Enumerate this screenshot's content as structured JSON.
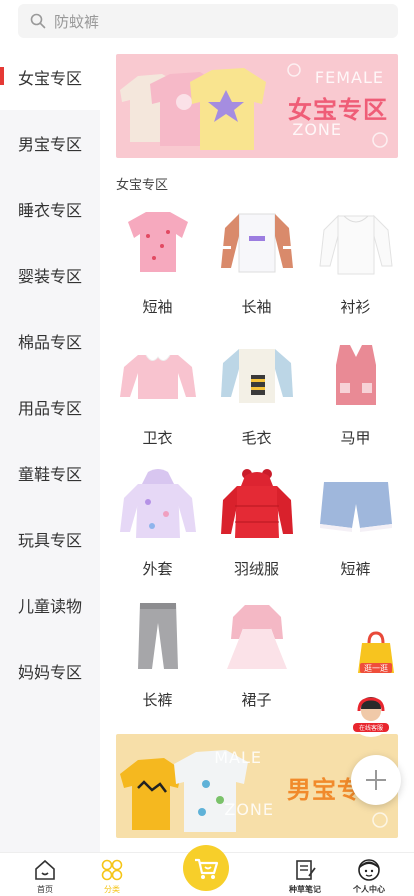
{
  "search": {
    "placeholder": "防蚊裤"
  },
  "sidebar": {
    "items": [
      {
        "label": "女宝专区"
      },
      {
        "label": "男宝专区"
      },
      {
        "label": "睡衣专区"
      },
      {
        "label": "婴装专区"
      },
      {
        "label": "棉品专区"
      },
      {
        "label": "用品专区"
      },
      {
        "label": "童鞋专区"
      },
      {
        "label": "玩具专区"
      },
      {
        "label": "儿童读物"
      },
      {
        "label": "妈妈专区"
      }
    ]
  },
  "banner_top": {
    "en1": "FEMALE",
    "cn": "女宝专区",
    "en2": "ZONE"
  },
  "section": {
    "title": "女宝专区"
  },
  "products": [
    {
      "label": "短袖",
      "icon": "short-sleeve-icon"
    },
    {
      "label": "长袖",
      "icon": "long-sleeve-icon"
    },
    {
      "label": "衬衫",
      "icon": "shirt-icon"
    },
    {
      "label": "卫衣",
      "icon": "sweatshirt-icon"
    },
    {
      "label": "毛衣",
      "icon": "sweater-icon"
    },
    {
      "label": "马甲",
      "icon": "vest-icon"
    },
    {
      "label": "外套",
      "icon": "jacket-icon"
    },
    {
      "label": "羽绒服",
      "icon": "down-coat-icon"
    },
    {
      "label": "短裤",
      "icon": "shorts-icon"
    },
    {
      "label": "长裤",
      "icon": "pants-icon"
    },
    {
      "label": "裙子",
      "icon": "dress-icon"
    }
  ],
  "banner_bottom": {
    "en1": "MALE",
    "cn": "男宝专",
    "en2": "ZONE"
  },
  "floats": {
    "shop_label": "逛一逛",
    "service_label": "在线客服"
  },
  "tabbar": {
    "home": "首页",
    "category": "分类",
    "notes": "种草笔记",
    "me": "个人中心"
  },
  "colors": {
    "accent": "#e53935",
    "tab_active": "#f5c518",
    "cart": "#f7cf2a"
  }
}
